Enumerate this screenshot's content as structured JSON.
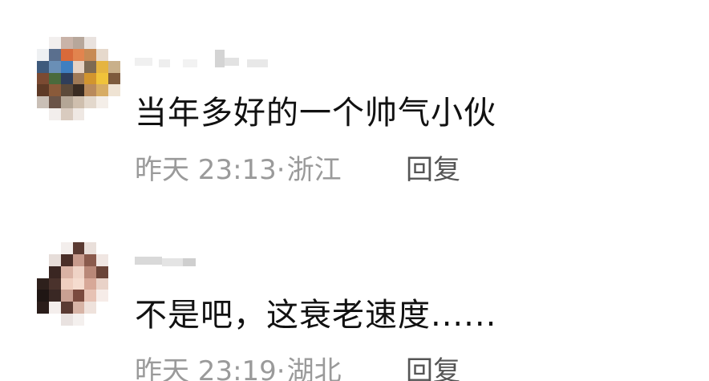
{
  "comments": [
    {
      "text": "当年多好的一个帅气小伙",
      "time": "昨天 23:13·",
      "location": "浙江",
      "reply_label": "回复"
    },
    {
      "text": "不是吧，这衰老速度......",
      "time": "昨天 23:19·",
      "location": "湖北",
      "reply_label": "回复"
    }
  ]
}
